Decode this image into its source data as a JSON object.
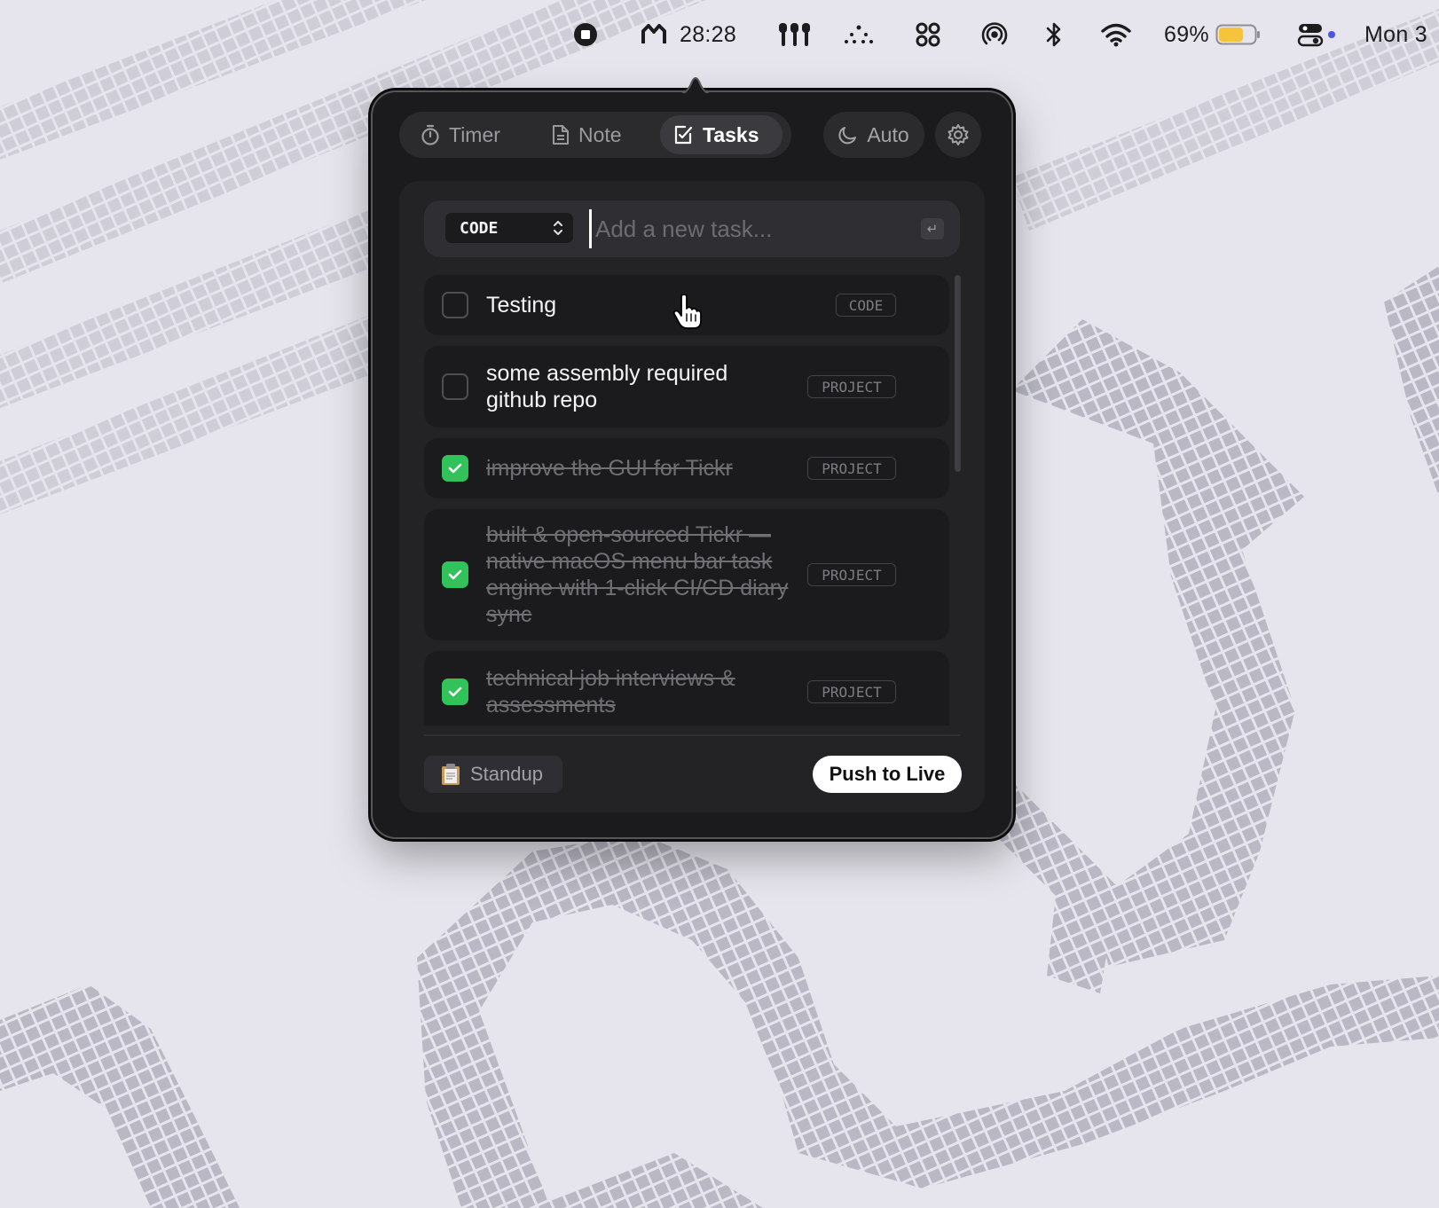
{
  "menubar": {
    "timer": "28:28",
    "battery": "69%",
    "battery_level": 0.69,
    "clock": "Mon 3",
    "icons": [
      "record-stop-icon",
      "app-logo-icon",
      "airpods-icon",
      "dots-icon",
      "grid-icon",
      "airdrop-icon",
      "bluetooth-icon",
      "wifi-icon",
      "battery-icon",
      "control-center-icon"
    ]
  },
  "tabs": [
    {
      "label": "Timer",
      "icon": "stopwatch-icon"
    },
    {
      "label": "Note",
      "icon": "note-icon"
    },
    {
      "label": "Tasks",
      "icon": "tasks-icon",
      "active": true
    }
  ],
  "auto": {
    "label": "Auto",
    "icon": "moon-icon"
  },
  "new_task": {
    "category": "CODE",
    "placeholder": "Add a new task...",
    "enter_hint": "↵"
  },
  "tasks": [
    {
      "text": "Testing",
      "tag": "CODE",
      "done": false
    },
    {
      "text": "some assembly required github repo",
      "tag": "PROJECT",
      "done": false
    },
    {
      "text": "improve the GUI for Tickr",
      "tag": "PROJECT",
      "done": true
    },
    {
      "text": "built & open-sourced Tickr — native macOS menu bar task engine with 1-click CI/CD diary sync",
      "tag": "PROJECT",
      "done": true
    },
    {
      "text": "technical job interviews & assessments",
      "tag": "PROJECT",
      "done": true
    }
  ],
  "footer": {
    "standup_label": "Standup",
    "standup_icon": "clipboard-icon",
    "push_label": "Push to Live"
  },
  "colors": {
    "accent_check": "#32c25a",
    "popover_bg": "#1b1b1d",
    "battery_fill": "#f6c33a"
  }
}
